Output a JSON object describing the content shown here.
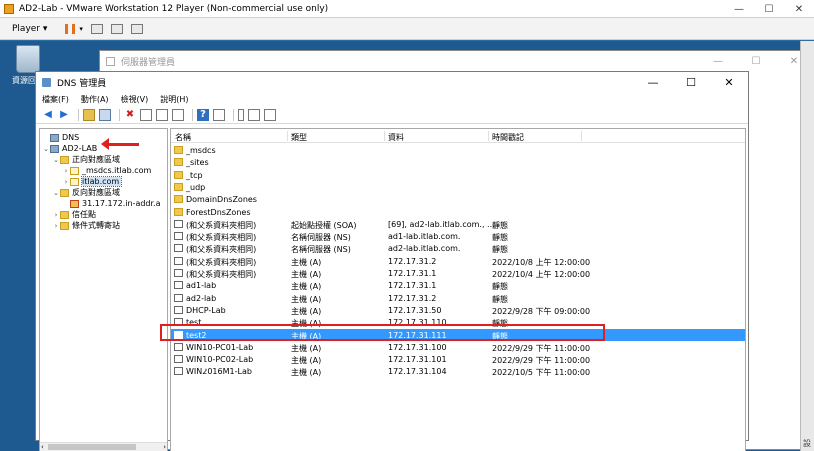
{
  "vm": {
    "title": "AD2-Lab - VMware Workstation 12 Player (Non-commercial use only)",
    "player_menu": "Player",
    "minimize": "—",
    "maximize": "☐",
    "close": "✕"
  },
  "desktop": {
    "recycle_bin": "資源回收"
  },
  "server_manager": {
    "title": "伺服器管理員",
    "minimize": "—",
    "maximize": "☐",
    "close": "✕"
  },
  "dns": {
    "title": "DNS 管理員",
    "minimize": "—",
    "maximize": "☐",
    "close": "✕",
    "menu": [
      "檔案(F)",
      "動作(A)",
      "檢視(V)",
      "說明(H)"
    ],
    "tree": {
      "root": "DNS",
      "server": "AD2-LAB",
      "forward": "正向對應區域",
      "msdcs": "_msdcs.itlab.com",
      "itlab": "itlab.com",
      "reverse": "反向對應區域",
      "reverse_zone": "31.17.172.in-addr.a",
      "trust": "信任點",
      "conditional": "條件式轉寄站"
    },
    "columns": {
      "name": "名稱",
      "type": "類型",
      "data": "資料",
      "timestamp": "時間戳記"
    },
    "records": [
      {
        "name": "_msdcs",
        "type": "",
        "data": "",
        "timestamp": "",
        "icon": "folder"
      },
      {
        "name": "_sites",
        "type": "",
        "data": "",
        "timestamp": "",
        "icon": "folder"
      },
      {
        "name": "_tcp",
        "type": "",
        "data": "",
        "timestamp": "",
        "icon": "folder"
      },
      {
        "name": "_udp",
        "type": "",
        "data": "",
        "timestamp": "",
        "icon": "folder"
      },
      {
        "name": "DomainDnsZones",
        "type": "",
        "data": "",
        "timestamp": "",
        "icon": "folder"
      },
      {
        "name": "ForestDnsZones",
        "type": "",
        "data": "",
        "timestamp": "",
        "icon": "folder"
      },
      {
        "name": "(和父系資料夾相同)",
        "type": "起始點授權 (SOA)",
        "data": "[69], ad2-lab.itlab.com., ...",
        "timestamp": "靜態",
        "icon": "record"
      },
      {
        "name": "(和父系資料夾相同)",
        "type": "名稱伺服器 (NS)",
        "data": "ad1-lab.itlab.com.",
        "timestamp": "靜態",
        "icon": "record"
      },
      {
        "name": "(和父系資料夾相同)",
        "type": "名稱伺服器 (NS)",
        "data": "ad2-lab.itlab.com.",
        "timestamp": "靜態",
        "icon": "record"
      },
      {
        "name": "(和父系資料夾相同)",
        "type": "主機 (A)",
        "data": "172.17.31.2",
        "timestamp": "2022/10/8 上午 12:00:00",
        "icon": "record"
      },
      {
        "name": "(和父系資料夾相同)",
        "type": "主機 (A)",
        "data": "172.17.31.1",
        "timestamp": "2022/10/4 上午 12:00:00",
        "icon": "record"
      },
      {
        "name": "ad1-lab",
        "type": "主機 (A)",
        "data": "172.17.31.1",
        "timestamp": "靜態",
        "icon": "record"
      },
      {
        "name": "ad2-lab",
        "type": "主機 (A)",
        "data": "172.17.31.2",
        "timestamp": "靜態",
        "icon": "record"
      },
      {
        "name": "DHCP-Lab",
        "type": "主機 (A)",
        "data": "172.17.31.50",
        "timestamp": "2022/9/28 下午 09:00:00",
        "icon": "record"
      },
      {
        "name": "test",
        "type": "主機 (A)",
        "data": "172.17.31.110",
        "timestamp": "靜態",
        "icon": "record"
      },
      {
        "name": "test2",
        "type": "主機 (A)",
        "data": "172.17.31.111",
        "timestamp": "靜態",
        "icon": "record",
        "selected": true
      },
      {
        "name": "WIN10-PC01-Lab",
        "type": "主機 (A)",
        "data": "172.17.31.100",
        "timestamp": "2022/9/29 下午 11:00:00",
        "icon": "record"
      },
      {
        "name": "WIN10-PC02-Lab",
        "type": "主機 (A)",
        "data": "172.17.31.101",
        "timestamp": "2022/9/29 下午 11:00:00",
        "icon": "record"
      },
      {
        "name": "WIN2016M1-Lab",
        "type": "主機 (A)",
        "data": "172.17.31.104",
        "timestamp": "2022/10/5 下午 11:00:00",
        "icon": "record"
      }
    ]
  },
  "side_label": "設"
}
